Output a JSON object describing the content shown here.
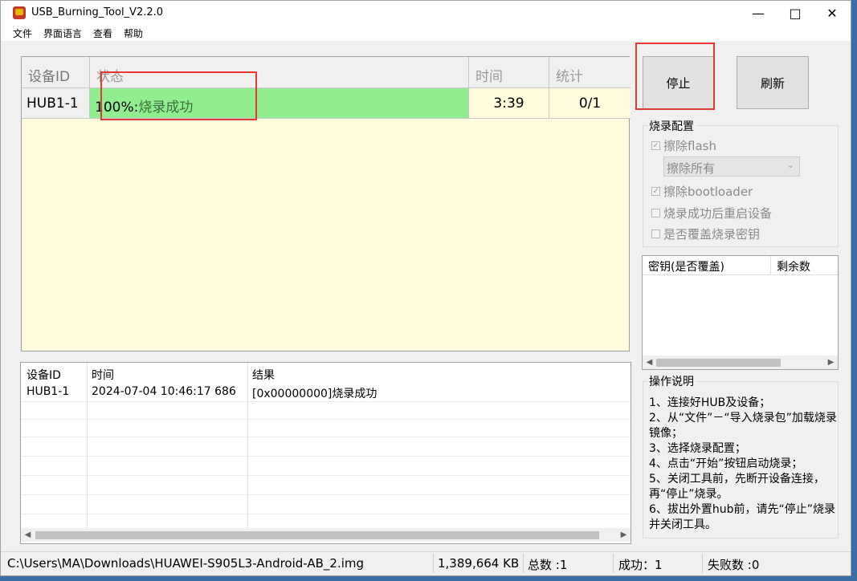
{
  "window": {
    "title": "USB_Burning_Tool_V2.2.0"
  },
  "titlebar_icons": {
    "minimize": "minimize-icon",
    "maximize": "maximize-icon",
    "close": "close-icon"
  },
  "menu": [
    "文件",
    "界面语言",
    "查看",
    "帮助"
  ],
  "device_grid": {
    "columns": [
      "设备ID",
      "状态",
      "时间",
      "统计"
    ],
    "rows": [
      {
        "id": "HUB1-1",
        "percent": "100%:",
        "status": "烧录成功",
        "time": "3:39",
        "stat": "0/1"
      }
    ]
  },
  "buttons": {
    "stop": "停止",
    "refresh": "刷新"
  },
  "burn_config": {
    "title": "烧录配置",
    "erase_flash": "擦除flash",
    "erase_mode": "擦除所有",
    "erase_bootloader": "擦除bootloader",
    "reboot_after": "烧录成功后重启设备",
    "overwrite_key": "是否覆盖烧录密钥"
  },
  "key_table": {
    "columns": [
      "密钥(是否覆盖)",
      "剩余数"
    ]
  },
  "log": {
    "columns": [
      "设备ID",
      "时间",
      "结果"
    ],
    "rows": [
      {
        "id": "HUB1-1",
        "time": "2024-07-04 10:46:17 686",
        "result": "[0x00000000]烧录成功"
      }
    ]
  },
  "instructions": {
    "title": "操作说明",
    "lines": [
      "1、连接好HUB及设备；",
      "2、从“文件”－“导入烧录包”加载烧录镜像；",
      "3、选择烧录配置；",
      "4、点击“开始”按钮启动烧录；",
      "5、关闭工具前，先断开设备连接，再“停止”烧录。",
      "6、拔出外置hub前，请先“停止”烧录并关闭工具。"
    ]
  },
  "status_bar": {
    "path": "C:\\Users\\MA\\Downloads\\HUAWEI-S905L3-Android-AB_2.img",
    "size": "1,389,664 KB",
    "total": "总数 :1",
    "success": "成功：1",
    "failed": "失败数 :0"
  },
  "colors": {
    "success_row": "#90ee90",
    "grid_bg": "#fffbdd",
    "highlight": "#e53935"
  }
}
